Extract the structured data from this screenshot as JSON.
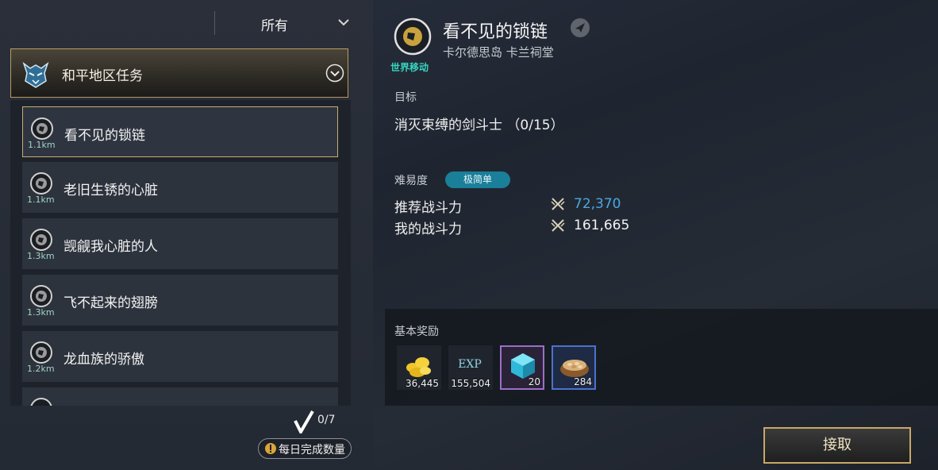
{
  "filter": {
    "label": "所有"
  },
  "category": {
    "label": "和平地区任务"
  },
  "quests": [
    {
      "name": "看不见的锁链",
      "distance": "1.1km",
      "selected": true
    },
    {
      "name": "老旧生锈的心脏",
      "distance": "1.1km"
    },
    {
      "name": "觊觎我心脏的人",
      "distance": "1.3km"
    },
    {
      "name": "飞不起来的翅膀",
      "distance": "1.3km"
    },
    {
      "name": "龙血族的骄傲",
      "distance": "1.2km"
    }
  ],
  "daily": {
    "progress": "0/7",
    "label": "每日完成数量"
  },
  "detail": {
    "world_label": "世界移动",
    "title": "看不见的锁链",
    "location": "卡尔德思岛 卡兰祠堂",
    "goal_heading": "目标",
    "goal_text": "消灭束缚的剑斗士 （0/15）",
    "difficulty_label": "难易度",
    "difficulty_value": "极简单",
    "recommended_label": "推荐战斗力",
    "recommended_value": "72,370",
    "my_power_label": "我的战斗力",
    "my_power_value": "161,665"
  },
  "rewards": {
    "heading": "基本奖励",
    "items": [
      {
        "icon": "gold-coins-icon",
        "count": "36,445"
      },
      {
        "icon": "exp-icon",
        "label": "EXP",
        "count": "155,504"
      },
      {
        "icon": "crystal-cube-icon",
        "count": "20"
      },
      {
        "icon": "seed-bowl-icon",
        "count": "284"
      }
    ]
  },
  "accept": {
    "label": "接取"
  },
  "colors": {
    "accent_gold": "#c9ac73",
    "recommended_power": "#4aa8e0",
    "world_label": "#36d6c0",
    "difficulty_badge": "#1a7f99"
  }
}
